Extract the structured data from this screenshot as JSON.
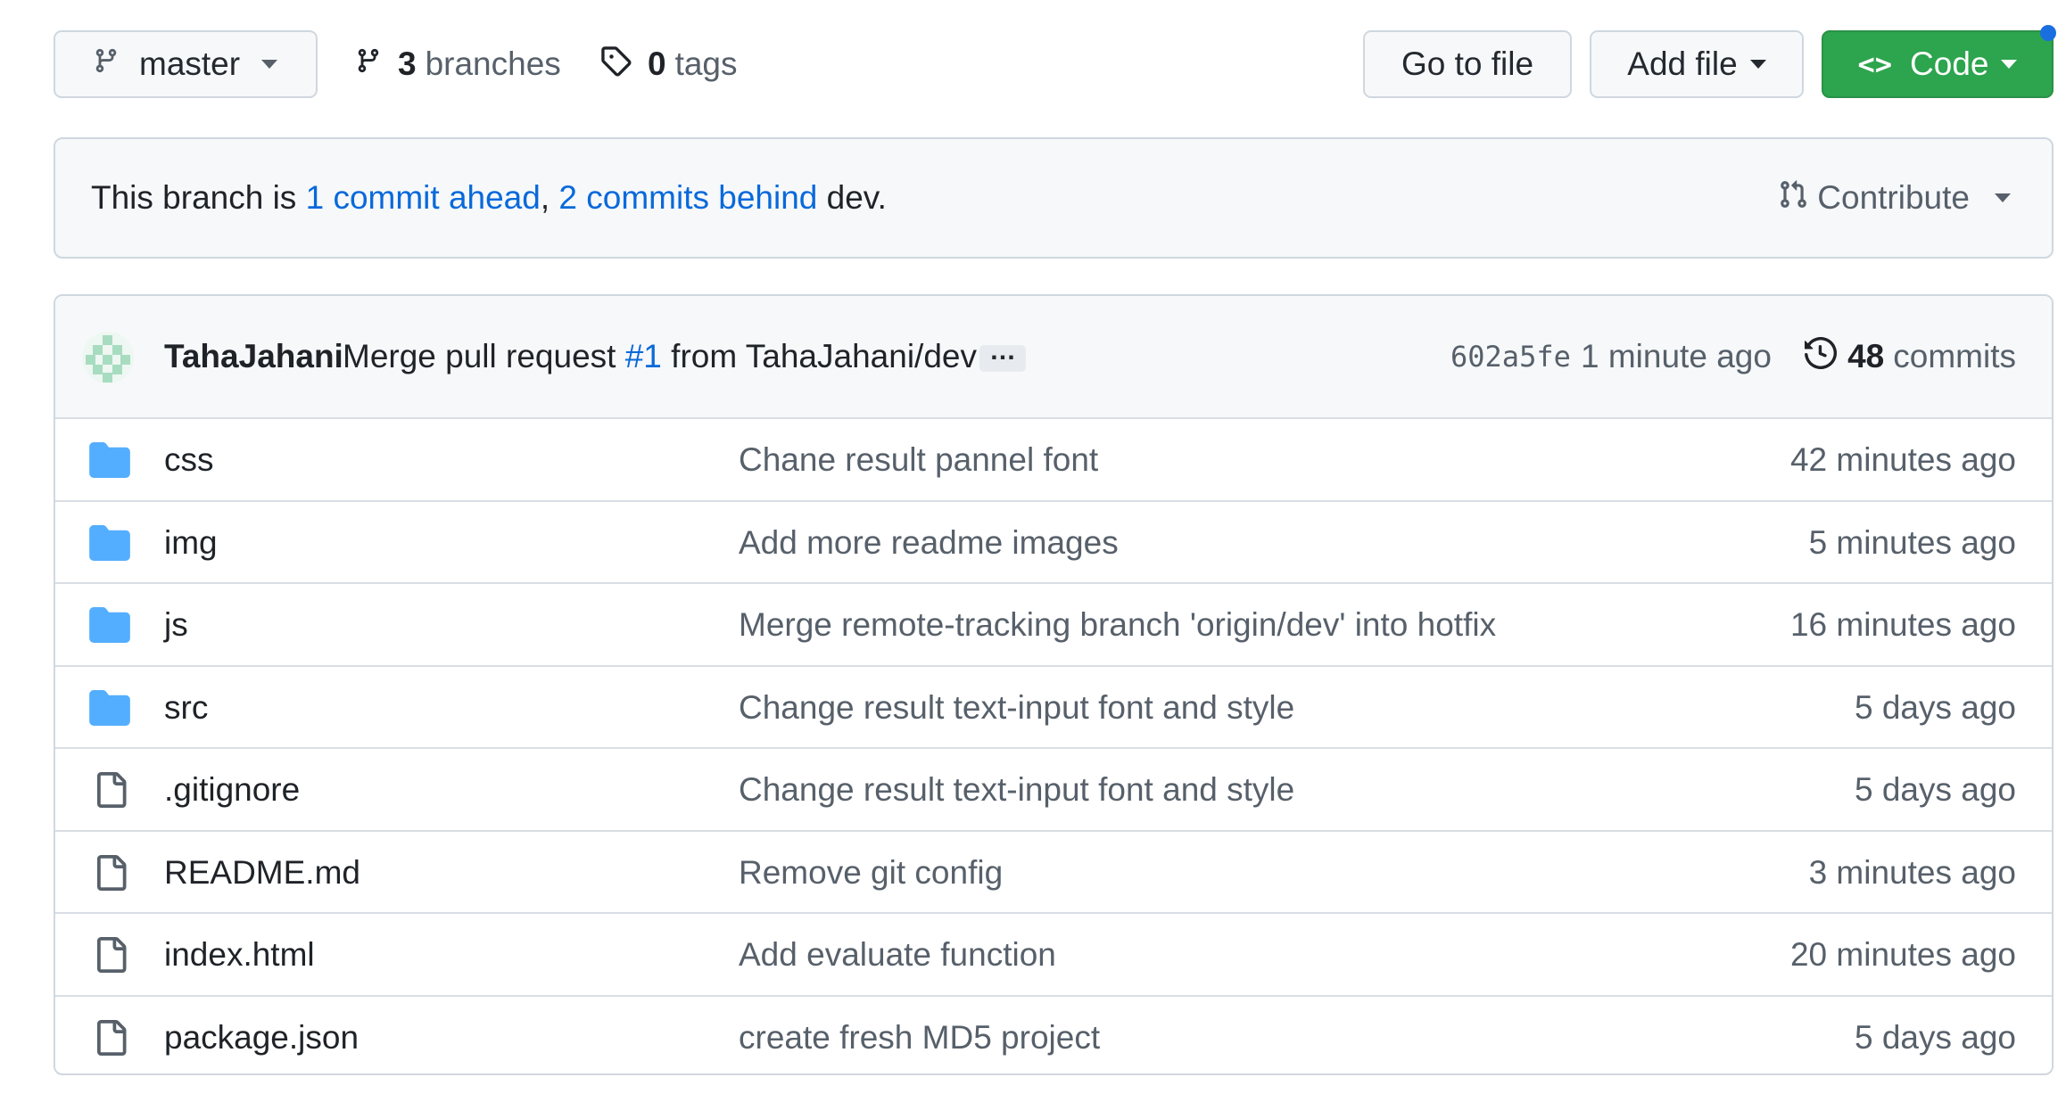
{
  "toolbar": {
    "branch_label": "master",
    "branches_count": "3",
    "branches_label": "branches",
    "tags_count": "0",
    "tags_label": "tags",
    "go_to_file_label": "Go to file",
    "add_file_label": "Add file",
    "code_label": "Code"
  },
  "branch_info": {
    "prefix": "This branch is ",
    "ahead_link": "1 commit ahead",
    "separator": ", ",
    "behind_link": "2 commits behind",
    "suffix": " dev.",
    "contribute_label": "Contribute"
  },
  "latest_commit": {
    "author": "TahaJahani",
    "message_prefix": "Merge pull request ",
    "pr_link": "#1",
    "message_suffix": " from TahaJahani/dev",
    "ellipsis": "…",
    "sha": "602a5fe",
    "time": "1 minute ago",
    "commits_count": "48",
    "commits_label": "commits"
  },
  "files": [
    {
      "type": "folder",
      "icon": "folder-icon",
      "name": "css",
      "message": "Chane result pannel font",
      "age": "42 minutes ago"
    },
    {
      "type": "folder",
      "icon": "folder-icon",
      "name": "img",
      "message": "Add more readme images",
      "age": "5 minutes ago"
    },
    {
      "type": "folder",
      "icon": "folder-icon",
      "name": "js",
      "message": "Merge remote-tracking branch 'origin/dev' into hotfix",
      "age": "16 minutes ago"
    },
    {
      "type": "folder",
      "icon": "folder-icon",
      "name": "src",
      "message": "Change result text-input font and style",
      "age": "5 days ago"
    },
    {
      "type": "file",
      "icon": "file-icon",
      "name": ".gitignore",
      "message": "Change result text-input font and style",
      "age": "5 days ago"
    },
    {
      "type": "file",
      "icon": "file-icon",
      "name": "README.md",
      "message": "Remove git config",
      "age": "3 minutes ago"
    },
    {
      "type": "file",
      "icon": "file-icon",
      "name": "index.html",
      "message": "Add evaluate function",
      "age": "20 minutes ago"
    },
    {
      "type": "file",
      "icon": "file-icon",
      "name": "package.json",
      "message": "create fresh MD5 project",
      "age": "5 days ago"
    }
  ],
  "colors": {
    "accent_link": "#0969da",
    "code_button": "#2da44e",
    "folder": "#54aeff",
    "notification_dot": "#1a6fe0"
  }
}
